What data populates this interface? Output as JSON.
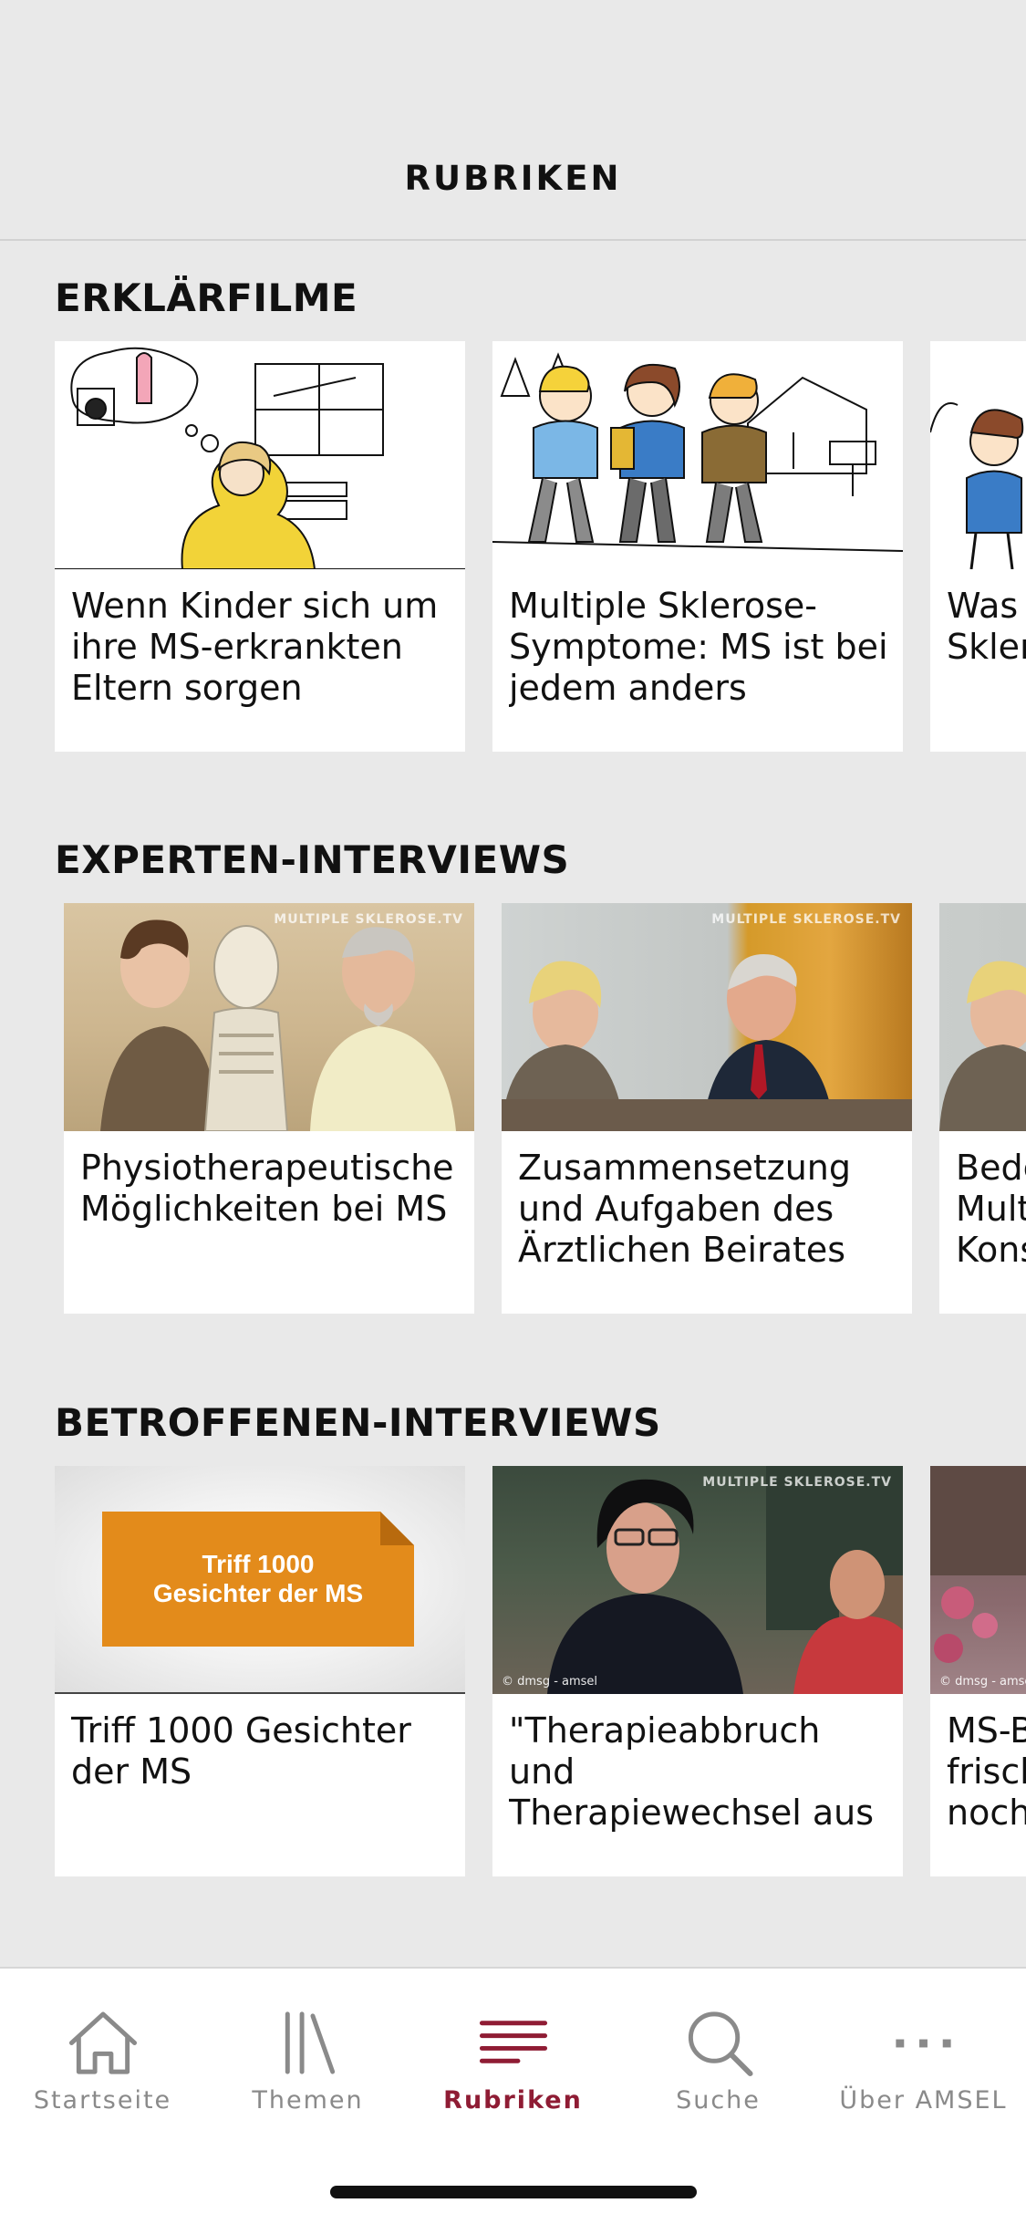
{
  "header": {
    "title": "RUBRIKEN"
  },
  "sections": [
    {
      "title": "ERKLÄRFILME",
      "cards": [
        {
          "title": "Wenn Kinder sich um\nihre MS-erkrankten\nEltern sorgen"
        },
        {
          "title": "Multiple Sklerose-\nSymptome: MS ist bei\njedem anders"
        },
        {
          "title": "Was\nSkler"
        }
      ]
    },
    {
      "title": "EXPERTEN-INTERVIEWS",
      "cards": [
        {
          "title": "Physiotherapeutische\nMöglichkeiten bei MS",
          "watermark": "MULTIPLE SKLEROSE.TV"
        },
        {
          "title": "Zusammensetzung\nund Aufgaben des\nÄrztlichen Beirates d…",
          "watermark": "MULTIPLE SKLEROSE.TV"
        },
        {
          "title": "Bede\nMult\nKons"
        }
      ]
    },
    {
      "title": "BETROFFENEN-INTERVIEWS",
      "cards": [
        {
          "title": "Triff 1000 Gesichter\nder MS",
          "tag_line1": "Triff 1000",
          "tag_line2": "Gesichter der MS"
        },
        {
          "title": "\"Therapieabbruch und\nTherapiewechsel aus\nPatientensicht\"",
          "watermark": "MULTIPLE SKLEROSE.TV",
          "copyright": "© dmsg - amsel"
        },
        {
          "title": "MS-B\nfrisch\nnoch",
          "copyright": "© dmsg - amsel"
        }
      ]
    }
  ],
  "tabs": [
    {
      "label": "Startseite",
      "icon": "home-icon",
      "active": false
    },
    {
      "label": "Themen",
      "icon": "library-icon",
      "active": false
    },
    {
      "label": "Rubriken",
      "icon": "list-lines-icon",
      "active": true
    },
    {
      "label": "Suche",
      "icon": "search-icon",
      "active": false
    },
    {
      "label": "Über AMSEL",
      "icon": "more-dots-icon",
      "active": false
    }
  ],
  "colors": {
    "accent": "#8f1c34",
    "inactive": "#8a8a8a",
    "background": "#e9e9e9",
    "orange": "#e38b1b"
  }
}
